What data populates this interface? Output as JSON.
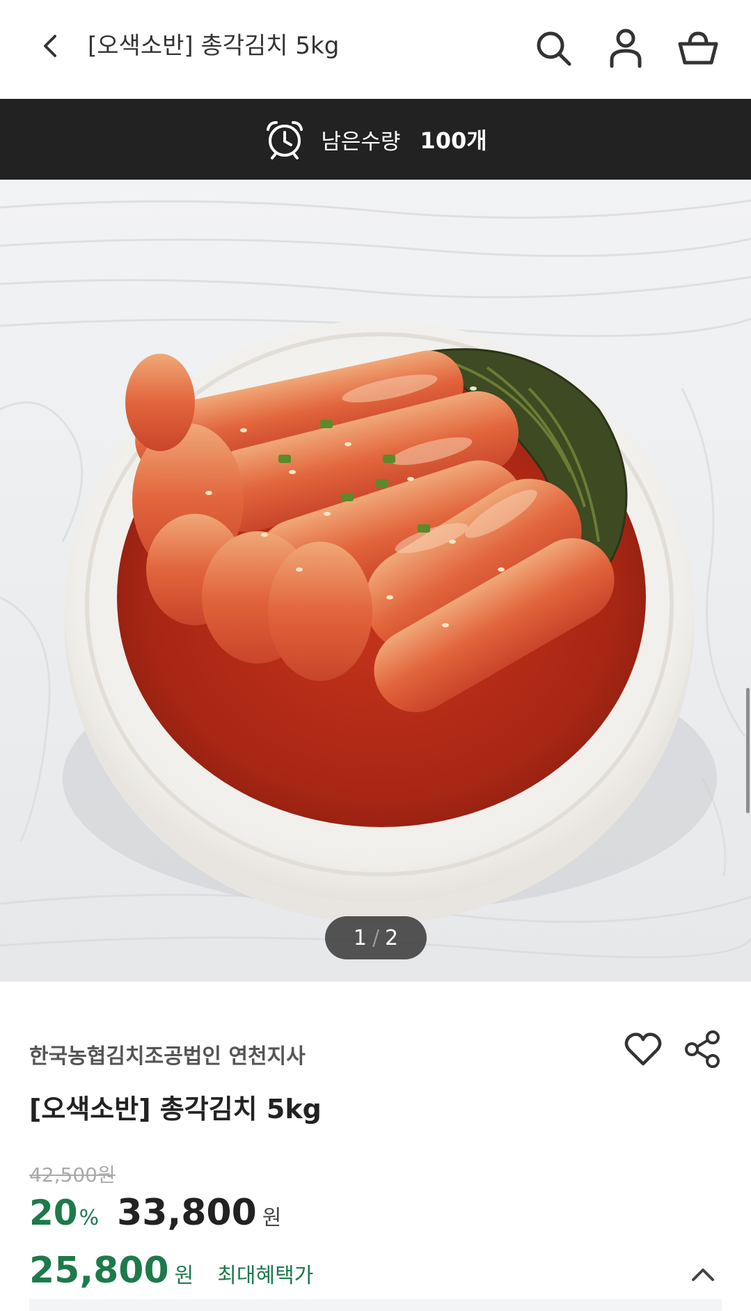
{
  "header": {
    "title": "[오색소반] 총각김치 5kg",
    "icons": [
      "back-icon",
      "search-icon",
      "user-icon",
      "cart-icon"
    ]
  },
  "stock_banner": {
    "icon": "alarm-clock-icon",
    "label": "남은수량",
    "count": "100개"
  },
  "gallery": {
    "current": "1",
    "separator": "/",
    "total": "2"
  },
  "product": {
    "seller": "한국농협김치조공법인 연천지사",
    "name": "[오색소반] 총각김치 5kg",
    "original_price": "42,500원",
    "discount_rate": "20",
    "discount_symbol": "%",
    "sale_price": "33,800",
    "sale_unit": "원",
    "benefit_price": "25,800",
    "benefit_unit": "원",
    "benefit_label": "최대혜택가"
  },
  "colors": {
    "accent_green": "#1e7a4a",
    "banner_bg": "#222222",
    "strike_gray": "#aaaaaa"
  }
}
